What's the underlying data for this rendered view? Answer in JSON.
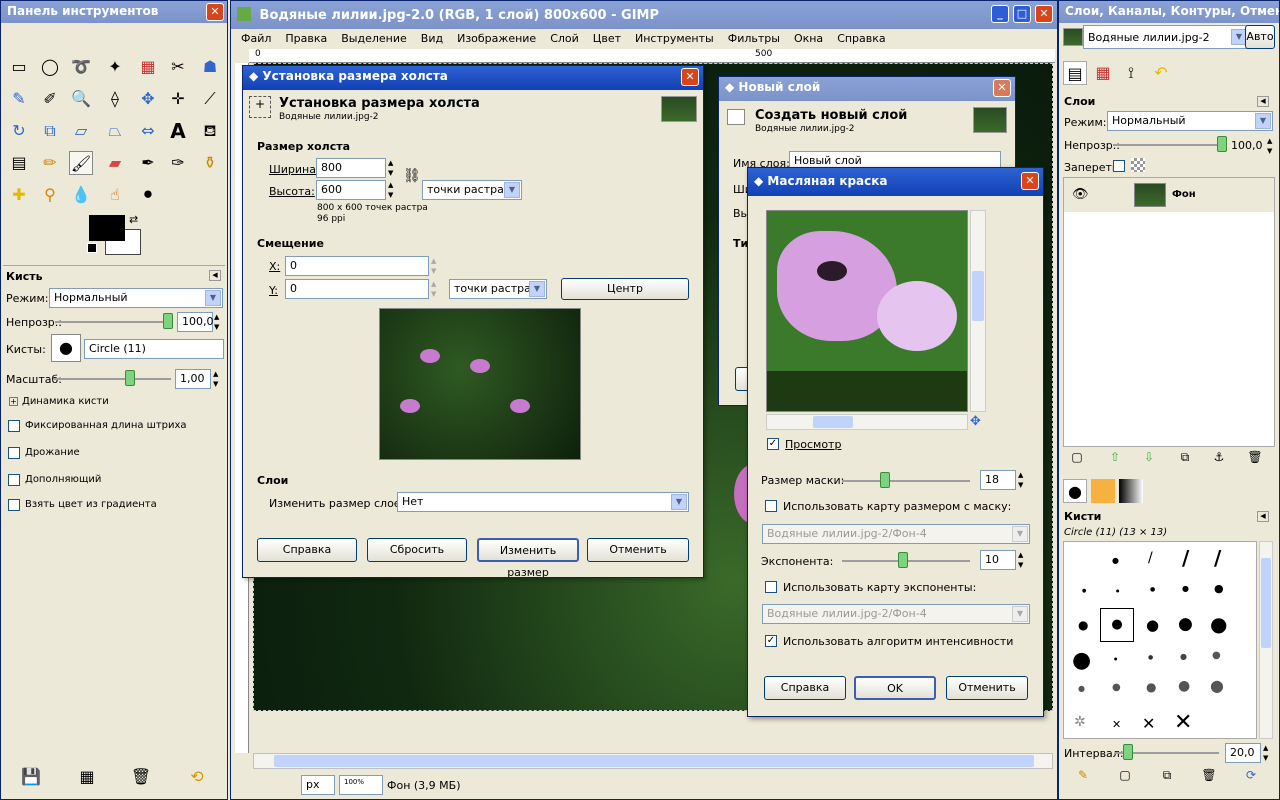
{
  "toolbox": {
    "title": "Панель инструментов",
    "tool_options_title": "Кисть",
    "mode_label": "Режим:",
    "mode_value": "Нормальный",
    "opacity_label": "Непрозр.:",
    "opacity_value": "100,0",
    "brushes_label": "Кисты:",
    "brush_value": "Circle (11)",
    "scale_label": "Масштаб:",
    "scale_value": "1,00",
    "dynamics_label": "Динамика кисти",
    "options": [
      "Фиксированная длина штриха",
      "Дрожание",
      "Дополняющий",
      "Взять цвет из градиента"
    ]
  },
  "main_window": {
    "title": "Водяные лилии.jpg-2.0 (RGB, 1 слой) 800x600 - GIMP",
    "menu": [
      "Файл",
      "Правка",
      "Выделение",
      "Вид",
      "Изображение",
      "Слой",
      "Цвет",
      "Инструменты",
      "Фильтры",
      "Окна",
      "Справка"
    ],
    "ruler_marks": [
      "0",
      "500"
    ],
    "status_unit": "px",
    "status_zoom": "100%",
    "status_text": "Фон (3,9 МБ)"
  },
  "canvas_size_dialog": {
    "title": "Установка размера холста",
    "heading": "Установка размера холста",
    "subheading": "Водяные лилии.jpg-2",
    "section_size": "Размер холста",
    "width_label": "Ширина:",
    "width_value": "800",
    "height_label": "Высота:",
    "height_value": "600",
    "unit": "точки растра",
    "info_line1": "800 x 600 точек растра",
    "info_line2": "96 ppi",
    "section_offset": "Смещение",
    "x_label": "X:",
    "x_value": "0",
    "y_label": "Y:",
    "y_value": "0",
    "offset_unit": "точки растра",
    "center_button": "Центр",
    "section_layers": "Слои",
    "resize_layers_label": "Изменить размер слоев:",
    "resize_layers_value": "Нет",
    "buttons": [
      "Справка",
      "Сбросить",
      "Изменить размер",
      "Отменить"
    ]
  },
  "new_layer_dialog": {
    "title": "Новый слой",
    "heading": "Создать новый слой",
    "subheading": "Водяные лилии.jpg-2",
    "name_label": "Имя слоя:",
    "name_value": "Новый слой",
    "width_label_partial": "Ши",
    "height_label_partial": "Вы",
    "type_label_partial": "Ти"
  },
  "oilify_dialog": {
    "title": "Масляная краска",
    "preview_label": "Просмотр",
    "mask_size_label": "Размер маски:",
    "mask_size_value": "18",
    "use_mask_map_label": "Использовать карту размером с маску:",
    "mask_map_value": "Водяные лилии.jpg-2/Фон-4",
    "exponent_label": "Экспонента:",
    "exponent_value": "10",
    "use_exp_map_label": "Использовать карту экспоненты:",
    "exp_map_value": "Водяные лилии.jpg-2/Фон-4",
    "intensity_label": "Использовать алгоритм интенсивности",
    "buttons": [
      "Справка",
      "OK",
      "Отменить"
    ]
  },
  "layers_dock": {
    "title": "Слои, Каналы, Контуры, Отменит...",
    "image_combo": "Водяные лилии.jpg-2",
    "auto_button": "Авто",
    "layers_title": "Слои",
    "mode_label": "Режим:",
    "mode_value": "Нормальный",
    "opacity_label": "Непрозр.:",
    "opacity_value": "100,0",
    "lock_label": "Запереть:",
    "layer_name": "Фон",
    "brushes_title": "Кисти",
    "brush_name": "Circle (11) (13 × 13)",
    "interval_label": "Интервал:",
    "interval_value": "20,0"
  },
  "colors": {
    "title_active": "#1f4fc4",
    "accent": "#316ac5"
  }
}
